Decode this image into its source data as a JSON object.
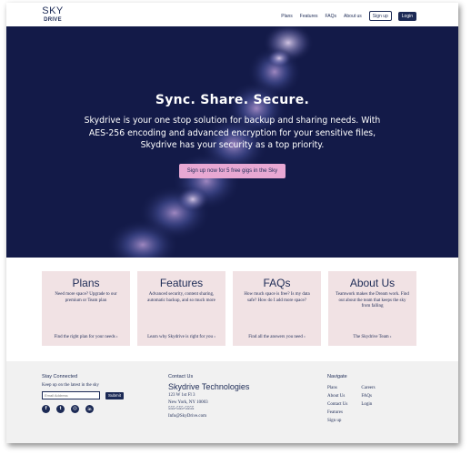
{
  "brand": {
    "logo_top": "SKY",
    "logo_bottom": "DRIVE"
  },
  "nav": {
    "links": [
      "Plans",
      "Features",
      "FAQs",
      "About us"
    ],
    "signup_label": "Sign up",
    "login_label": "Login"
  },
  "hero": {
    "title": "Sync. Share. Secure.",
    "text": "Skydrive is your one stop solution for backup and sharing needs. With AES-256 encoding and advanced encryption for your sensitive files, Skydrive has your security as a top priority.",
    "cta": "Sign up now for 5 free gigs in the Sky"
  },
  "cards": [
    {
      "title": "Plans",
      "body": "Need more space? Upgrade to our premium or Team plan",
      "link": "Find the right plan for your needs ›"
    },
    {
      "title": "Features",
      "body": "Advanced security, content sharing, automatic backup, and so much more",
      "link": "Learn why Skydrive is right for you ›"
    },
    {
      "title": "FAQs",
      "body": "How much space is free? Is my data safe? How do I add more space?",
      "link": "Find all the answers you need ›"
    },
    {
      "title": "About Us",
      "body": "Teamwork makes the Dream work. Find out about the team that keeps the sky from falling",
      "link": "The Skydrive Team ›"
    }
  ],
  "footer": {
    "connected": {
      "heading": "Stay Connected",
      "subtext": "Keep up on the latest in the sky",
      "email_placeholder": "Email Address",
      "submit_label": "Submit",
      "socials": [
        {
          "name": "facebook-icon",
          "glyph": "f"
        },
        {
          "name": "twitter-icon",
          "glyph": "t"
        },
        {
          "name": "instagram-icon",
          "glyph": "◎"
        },
        {
          "name": "linkedin-icon",
          "glyph": "in"
        }
      ]
    },
    "contact": {
      "heading": "Contact Us",
      "company": "Skydrive Technologies",
      "address1": "123 W 1st Fl 3",
      "address2": "New York, NY 10003",
      "phone": "555-555-5555",
      "email": "Info@SkyDrive.com"
    },
    "navigate": {
      "heading": "Navigate",
      "col1": [
        "Plans",
        "About Us",
        "Contact Us",
        "Features",
        "Sign up"
      ],
      "col2": [
        "Careers",
        "FAQs",
        "Login"
      ]
    }
  },
  "colors": {
    "navy": "#1c2a55",
    "hero_bg": "#131a48",
    "cta_pink": "#e8a8d3",
    "card_bg": "#f1e2e4",
    "footer_bg": "#f1f1f1"
  }
}
